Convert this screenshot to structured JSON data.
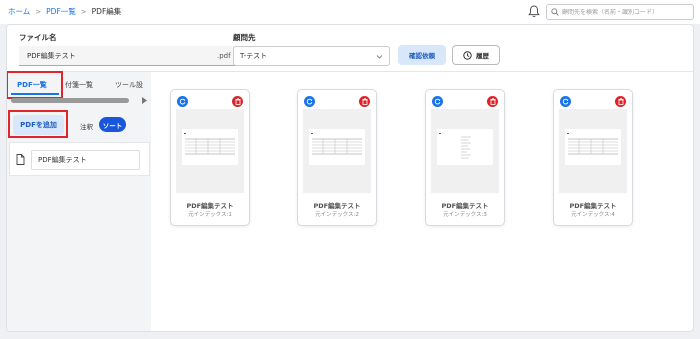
{
  "breadcrumb": {
    "home": "ホーム",
    "pdf_list": "PDF一覧",
    "current": "PDF編集"
  },
  "search": {
    "placeholder": "顧問先を検索（名前・識別コード）"
  },
  "form": {
    "file_name_label": "ファイル名",
    "file_name_value": "PDF編集テスト",
    "file_ext": ".pdf",
    "client_label": "顧問先",
    "client_value": "T-テスト",
    "confirm_button": "確認依頼",
    "history_button": "履歴"
  },
  "sidebar": {
    "tabs": [
      {
        "label": "PDF一覧",
        "active": true
      },
      {
        "label": "付箋一覧",
        "active": false
      },
      {
        "label": "ツール設",
        "active": false
      }
    ],
    "add_pdf_button": "PDFを追加",
    "note_label": "注釈",
    "sort_button": "ソート",
    "file_item": "PDF編集テスト"
  },
  "cards": [
    {
      "title": "PDF編集テスト",
      "index_label": "元インデックス:1"
    },
    {
      "title": "PDF編集テスト",
      "index_label": "元インデックス:2"
    },
    {
      "title": "PDF編集テスト",
      "index_label": "元インデックス:3"
    },
    {
      "title": "PDF編集テスト",
      "index_label": "元インデックス:4"
    }
  ],
  "colors": {
    "accent": "#1a73e8",
    "danger": "#d8262c",
    "highlight_box": "#e0252b",
    "soft_button": "#d9e7fb"
  },
  "icons": [
    "bell-icon",
    "search-icon",
    "chevron-down-icon",
    "clock-icon",
    "file-icon",
    "rotate-icon",
    "trash-icon"
  ]
}
